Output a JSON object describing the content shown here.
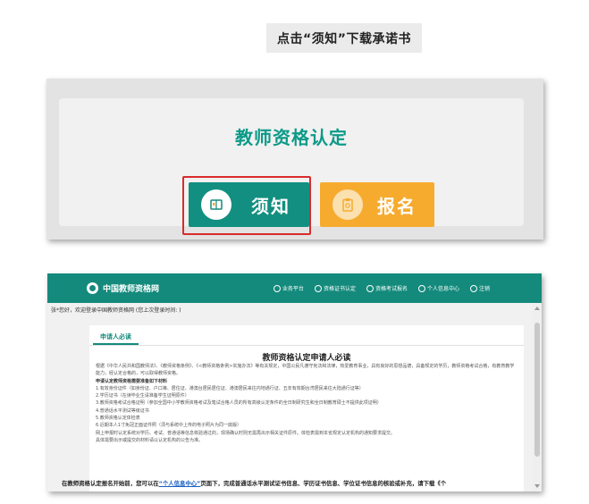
{
  "instruction": "点击“须知”下载承诺书",
  "panel1": {
    "title": "教师资格认定",
    "notice_button": "须知",
    "register_button": "报名"
  },
  "panel2": {
    "site_name": "中国教师资格网",
    "nav": [
      "业务平台",
      "资格证书认定",
      "资格考试报名",
      "个人信息中心",
      "注销"
    ],
    "greeting": "张*您好，欢迎登录中国教师资格网 (您上次登录时间: )",
    "tab": "申请人必读",
    "doc_title": "教师资格认定申请人必读",
    "paragraphs": [
      "根据《中华人民共和国教师法》、《教师资格条例》、《<教师资格条例>实施办法》等有关规定，中国公民凡遵守宪法和法律，热爱教育事业，具有良好的思想品德，具备规定的学历，教师资格考试合格，有教育教学能力，经认定合格的，可以取得教师资格。",
      "申请认定教师资格需要准备如下材料",
      "1.有效身份证件（如身份证、户口簿、居住证、港澳台居民居住证、港澳居民来往内地通行证、五年有效期台湾居民来往大陆通行证等）",
      "2.学历证书（在读毕业生请准备学生证明原件）",
      "3.教师资格考试合格证明（参加全国中小学教师资格考试及笔试合格人员的所有高级认定条件的全日制研究生和全日制教育硕士不提供此项证明）",
      "4.普通话水平测试等级证书",
      "5.教师资格认定体检表",
      "6.近期本人1寸免冠正面证件照（须与系统中上传的电子照片为同一底版）",
      "网上申报时认定系统对学历、考试、普通话等信息核验通过的，现场确认时则无需再出示相关证件原件。体检表需到本省规定认定机构的通知要求提交。",
      "具体需要出示或提交的材料请以认定机构的公告为准。"
    ],
    "bottom_line_prefix": "在教师资格认定报名开始前，您可以在",
    "bottom_link": "“个人信息中心”",
    "bottom_line_suffix": "页面下，完成普通话水平测试证书信息、学历证书信息、学位证书信息的核验或补充，请下载《个"
  }
}
